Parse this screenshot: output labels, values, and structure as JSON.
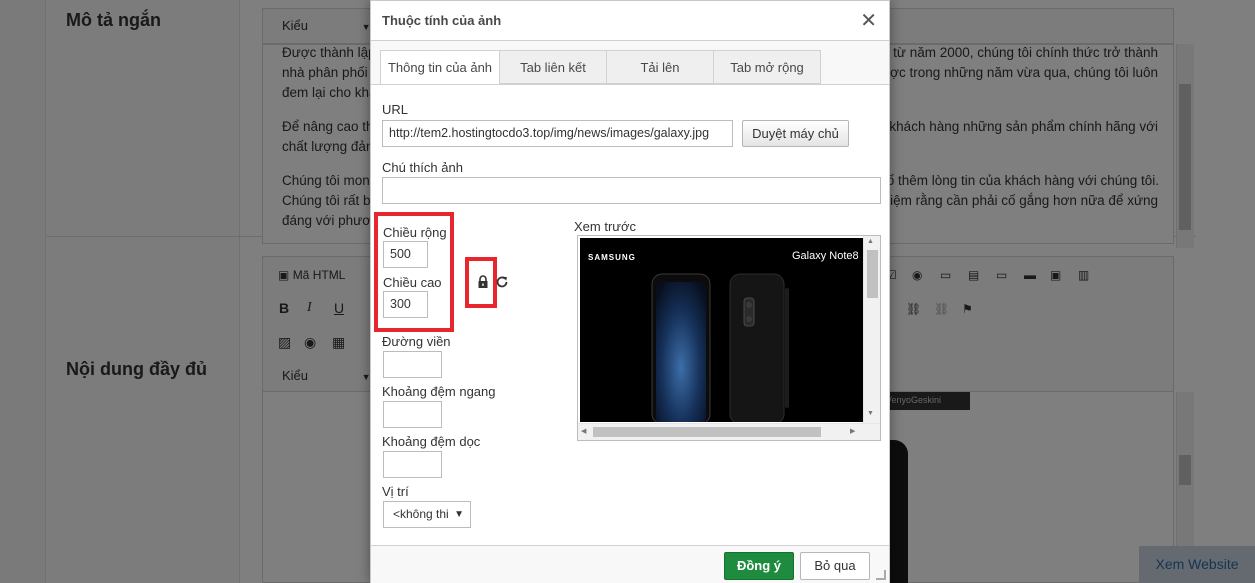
{
  "background": {
    "short_desc_label": "Mô tả ngắn",
    "full_content_label": "Nội dung đầy đủ",
    "style_dropdown_label": "Kiểu",
    "paragraph_1_left": "Được thành lập",
    "paragraph_1_left_2": "nhà phân phối",
    "paragraph_1_left_3": "đem lại cho khá",
    "paragraph_1_right": "e từ năm 2000, chúng tôi chính thức trở thành",
    "paragraph_1_right_2": "ược trong những năm vừa qua, chúng tôi luôn",
    "paragraph_2_left": "Để nâng cao th",
    "paragraph_2_left_2": "chất lượng đản",
    "paragraph_2_right": "khách hàng những sản phẩm chính hãng với",
    "paragraph_3_left": "Chúng tôi mong",
    "paragraph_3_left_2": "Chúng tôi rất b",
    "paragraph_3_left_3": "đáng với phươ",
    "paragraph_3_right": "cố thêm lòng tin của khách hàng với chúng tôi.",
    "paragraph_3_right_2": "iệm rằng cần phải cố gắng hơn nữa để xứng",
    "html_mode_label": "Mã HTML",
    "image_caption": "VenyoGeskini",
    "website_button": "Xem Website"
  },
  "dialog": {
    "title": "Thuộc tính của ảnh",
    "close_symbol": "✕",
    "tabs": [
      {
        "label": "Thông tin của ảnh",
        "active": true
      },
      {
        "label": "Tab liên kết",
        "active": false
      },
      {
        "label": "Tải lên",
        "active": false
      },
      {
        "label": "Tab mở rộng",
        "active": false
      }
    ],
    "url_label": "URL",
    "url_value": "http://tem2.hostingtocdo3.top/img/news/images/galaxy.jpg",
    "browse_button": "Duyệt máy chủ",
    "alt_label": "Chú thích ảnh",
    "alt_value": "",
    "width_label": "Chiều rộng",
    "width_value": "500",
    "height_label": "Chiều cao",
    "height_value": "300",
    "border_label": "Đường viền",
    "border_value": "",
    "hspace_label": "Khoảng đệm ngang",
    "hspace_value": "",
    "vspace_label": "Khoảng đệm dọc",
    "vspace_value": "",
    "align_label": "Vị trí",
    "align_value": "<không thi",
    "preview_label": "Xem trước",
    "preview_brand": "SAMSUNG",
    "preview_model": "Galaxy Note8",
    "ok_button": "Đồng ý",
    "cancel_button": "Bỏ qua"
  },
  "colors": {
    "highlight_red": "#e8262d",
    "ok_green": "#1e8b3e",
    "overlay": "rgba(0,0,0,0.5)"
  }
}
